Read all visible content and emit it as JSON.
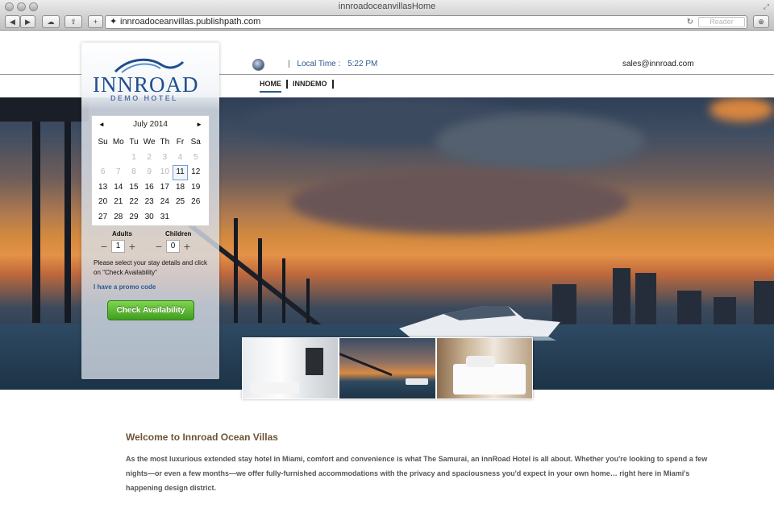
{
  "browser": {
    "window_title": "innroadoceanvillasHome",
    "url": "innroadoceanvillas.publishpath.com",
    "reader_label": "Reader"
  },
  "header": {
    "local_time_label": "Local Time :",
    "local_time_value": "5:22 PM",
    "email": "sales@innroad.com",
    "nav": [
      {
        "label": "HOME",
        "active": true
      },
      {
        "label": "INNDEMO",
        "active": false
      }
    ]
  },
  "logo": {
    "name": "INNROAD",
    "sub": "DEMO HOTEL"
  },
  "calendar": {
    "month_label": "July 2014",
    "prev": "◄",
    "next": "►",
    "days_of_week": [
      "Su",
      "Mo",
      "Tu",
      "We",
      "Th",
      "Fr",
      "Sa"
    ],
    "selected_day": 11,
    "weeks": [
      [
        "",
        "",
        "1",
        "2",
        "3",
        "4",
        "5"
      ],
      [
        "6",
        "7",
        "8",
        "9",
        "10",
        "11",
        "12"
      ],
      [
        "13",
        "14",
        "15",
        "16",
        "17",
        "18",
        "19"
      ],
      [
        "20",
        "21",
        "22",
        "23",
        "24",
        "25",
        "26"
      ],
      [
        "27",
        "28",
        "29",
        "30",
        "31",
        "",
        ""
      ]
    ],
    "past_days_through": 10
  },
  "booking": {
    "adults_label": "Adults",
    "adults_value": "1",
    "children_label": "Children",
    "children_value": "0",
    "minus": "−",
    "plus": "+",
    "note": "Please select your stay details and click on \"Check Availability\"",
    "promo_link": "I have a promo code",
    "check_button": "Check Availability"
  },
  "welcome": {
    "title": "Welcome to Innroad Ocean Villas",
    "text": "As the most luxurious extended stay hotel in Miami, comfort and convenience is what The Samurai, an innRoad Hotel is all about. Whether you're looking to spend a few nights—or even a few months—we offer fully-furnished accommodations with the privacy and spaciousness you'd expect in your own home… right here in Miami's happening design district."
  },
  "colors": {
    "brand_blue": "#1e4e8c",
    "button_green": "#4fb12a",
    "welcome_brown": "#6b5436"
  }
}
